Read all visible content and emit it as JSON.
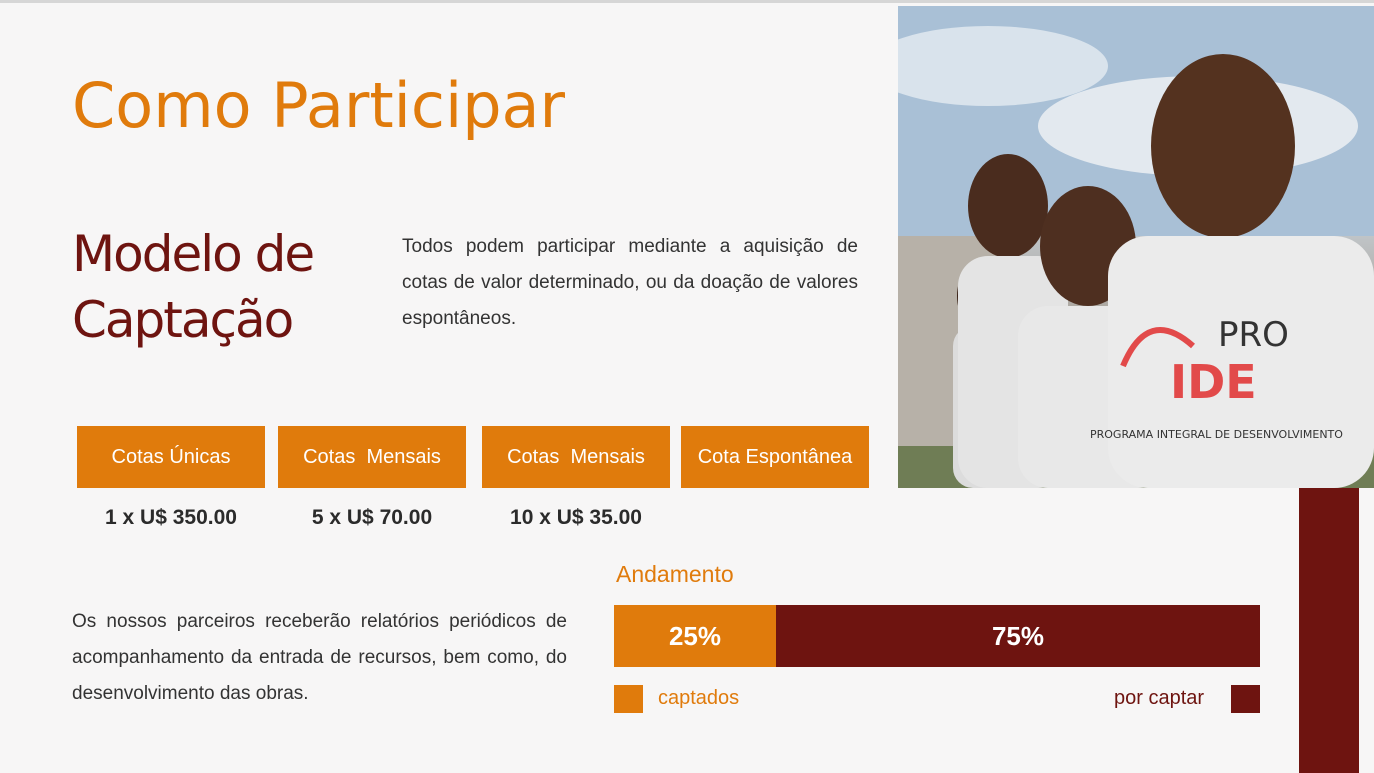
{
  "title": "Como Participar",
  "subtitle": {
    "line1": "Modelo de",
    "line2": "Captação"
  },
  "intro": "Todos podem participar mediante a aquisição de cotas de valor determinado, ou da doação de valores espontâneos.",
  "cotas": [
    {
      "label": "Cotas Únicas",
      "price": "1 x U$ 350.00"
    },
    {
      "label": "Cotas  Mensais",
      "price": "5 x U$ 70.00"
    },
    {
      "label": "Cotas  Mensais",
      "price": "10 x U$ 35.00"
    },
    {
      "label": "Cota Espontânea",
      "price": ""
    }
  ],
  "partners_text": "Os nossos parceiros receberão relatórios periódicos de acompanhamento da entrada de recursos, bem como, do desenvolvimento das obras.",
  "progress": {
    "title": "Andamento",
    "captured_label": "25%",
    "captured_fraction": 0.25,
    "remaining_label": "75%",
    "legend_captured": "captados",
    "legend_remaining": "por captar"
  },
  "photo": {
    "shirt_text_1": "PRO",
    "shirt_text_2": "IDE",
    "shirt_text_3": "PROGRAMA INTEGRAL DE DESENVOLVIMENTO"
  },
  "colors": {
    "orange": "#e07b0c",
    "dark_red": "#6e1410"
  }
}
